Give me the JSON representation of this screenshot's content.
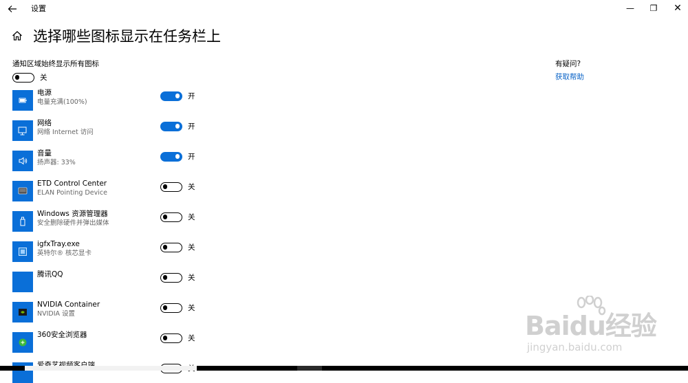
{
  "titlebar": {
    "back_icon": "back-arrow-icon",
    "title": "设置",
    "minimize_glyph": "—",
    "maximize_glyph": "❐",
    "close_glyph": "✕"
  },
  "page": {
    "home_icon": "home-icon",
    "title": "选择哪些图标显示在任务栏上"
  },
  "master": {
    "label": "通知区域始终显示所有图标",
    "state_text": "关",
    "on": false
  },
  "items": [
    {
      "name": "电源",
      "desc": "电量充满(100%)",
      "state_text": "开",
      "on": true,
      "icon": "battery-icon"
    },
    {
      "name": "网络",
      "desc": "网络 Internet 访问",
      "state_text": "开",
      "on": true,
      "icon": "network-monitor-icon"
    },
    {
      "name": "音量",
      "desc": "扬声器: 33%",
      "state_text": "开",
      "on": true,
      "icon": "speaker-icon"
    },
    {
      "name": "ETD Control Center",
      "desc": "ELAN Pointing Device",
      "state_text": "关",
      "on": false,
      "icon": "touchpad-icon"
    },
    {
      "name": "Windows 资源管理器",
      "desc": "安全删除硬件并弹出媒体",
      "state_text": "关",
      "on": false,
      "icon": "usb-drive-icon"
    },
    {
      "name": "igfxTray.exe",
      "desc": "英特尔® 核芯显卡",
      "state_text": "关",
      "on": false,
      "icon": "intel-graphics-icon"
    },
    {
      "name": "腾讯QQ",
      "desc": "",
      "state_text": "关",
      "on": false,
      "icon": "qq-icon"
    },
    {
      "name": "NVIDIA Container",
      "desc": "NVIDIA 设置",
      "state_text": "关",
      "on": false,
      "icon": "nvidia-icon"
    },
    {
      "name": "360安全浏览器",
      "desc": "",
      "state_text": "关",
      "on": false,
      "icon": "360-browser-icon"
    },
    {
      "name": "爱奇艺视频客户端",
      "desc": "",
      "state_text": "关",
      "on": false,
      "icon": "iqiyi-icon"
    }
  ],
  "help": {
    "title": "有疑问?",
    "link": "获取帮助"
  },
  "watermark": {
    "brand": "Baidu经验",
    "url": "jingyan.baidu.com"
  },
  "colors": {
    "accent": "#0a6fd8",
    "link": "#0a63c7",
    "secondary_text": "#666666"
  }
}
